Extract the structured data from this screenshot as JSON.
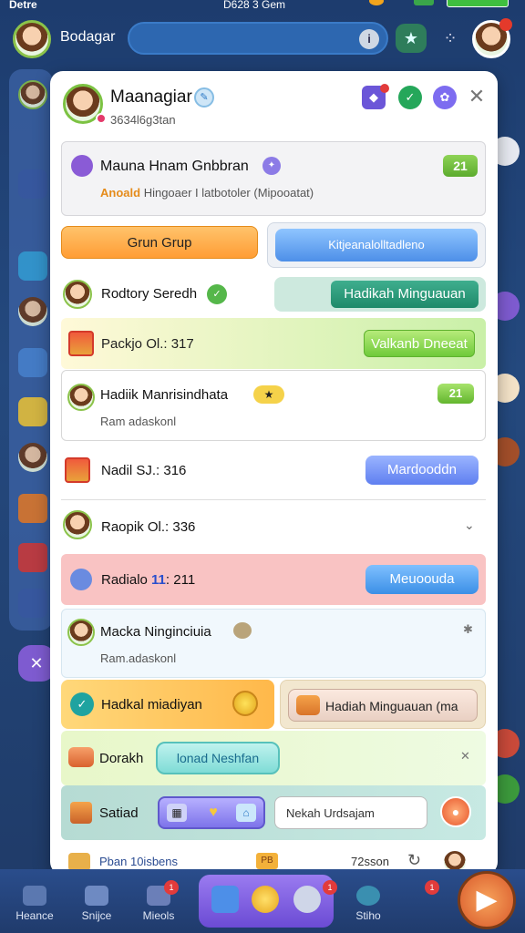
{
  "statusbar": {
    "left": "Detre",
    "center": "D628 3 Gem"
  },
  "topbar": {
    "name": "Bodagar",
    "search_icon": "info-icon"
  },
  "bottom_nav": [
    {
      "label": "Heance"
    },
    {
      "label": "Snijce"
    },
    {
      "label": "Mieols"
    },
    {
      "label": "Stiho"
    }
  ],
  "modal": {
    "title": "Maanagiar",
    "subtitle": "3634l6g3tan",
    "event": {
      "title": "Mauna Hnam Gnbbran",
      "badge": "21",
      "highlight": "Anoald",
      "subtext": "Hingoaer I latbotoler (Mipooatat)"
    },
    "grup_button": "Grun Grup",
    "blue_button": "Kitjeanalolltadleno",
    "row_rodtory": {
      "label": "Rodtory Seredh",
      "button": "Hadikah Minguauan"
    },
    "row_packjo": {
      "label": "Packjo Ol.: 317",
      "button": "Valkanb Dneeat"
    },
    "row_hadiik": {
      "label": "Hadiik Manrisindhata",
      "badge": "21",
      "subtext": "Ram adaskonl"
    },
    "row_nadil": {
      "label": "Nadil SJ.: 316",
      "button": "Mardooddn"
    },
    "row_raopik": {
      "label": "Raopik Ol.: 336"
    },
    "row_radiale": {
      "label": "Radialo",
      "num": "11",
      "tail": ": 211",
      "button": "Meuoouda"
    },
    "row_macka": {
      "label": "Macka Ninginciuia",
      "subtext": "Ram.adaskonl"
    },
    "row_hadkal": {
      "label": "Hadkal miadiyan",
      "button": "Hadiah Minguauan (ma"
    },
    "row_dorakh": {
      "label": "Dorakh",
      "button": "lonad Neshfan"
    },
    "row_satiad": {
      "label": "Satiad",
      "input": "Nekah Urdsajam"
    },
    "footer": {
      "left": "Pban 10isbens",
      "badge": "PB",
      "right": "72sson"
    }
  },
  "colors": {
    "accent": "#4d8fe8",
    "orange": "#ff9d35",
    "green": "#6fca3a",
    "teal": "#1f8a6a"
  }
}
